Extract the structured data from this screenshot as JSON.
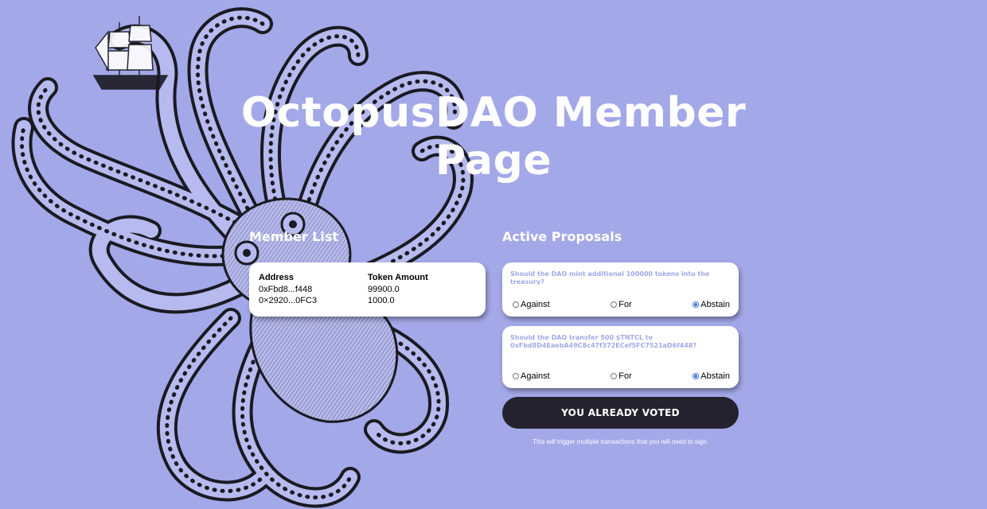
{
  "page": {
    "title_line1": "OctopusDAO Member",
    "title_line2": "Page"
  },
  "member_list": {
    "heading": "Member List",
    "columns": [
      "Address",
      "Token Amount"
    ],
    "rows": [
      [
        "0xFbd8...f448",
        "99900.0"
      ],
      [
        "0×2920...0FC3",
        "1000.0"
      ]
    ]
  },
  "proposals": {
    "heading": "Active Proposals",
    "items": [
      {
        "question": "Should the DAO mint additional 100000 tokens into the treasury?",
        "options": [
          "Against",
          "For",
          "Abstain"
        ],
        "selected": "Abstain"
      },
      {
        "question": "Should the DAO transfer 500 $TNTCL to 0xFbd8D4EaebA49C8c47f372ECef5FC7521aD6f448?",
        "options": [
          "Against",
          "For",
          "Abstain"
        ],
        "selected": "Abstain"
      }
    ]
  },
  "vote_button": {
    "label": "YOU ALREADY VOTED"
  },
  "footnote": "This will trigger multiple transactions that you will need to sign.",
  "colors": {
    "background": "#a3a8e8",
    "button": "#24222e",
    "card": "#ffffff",
    "question_text": "#a3a8e8"
  },
  "decorations": {
    "background_art": "octopus-illustration"
  }
}
